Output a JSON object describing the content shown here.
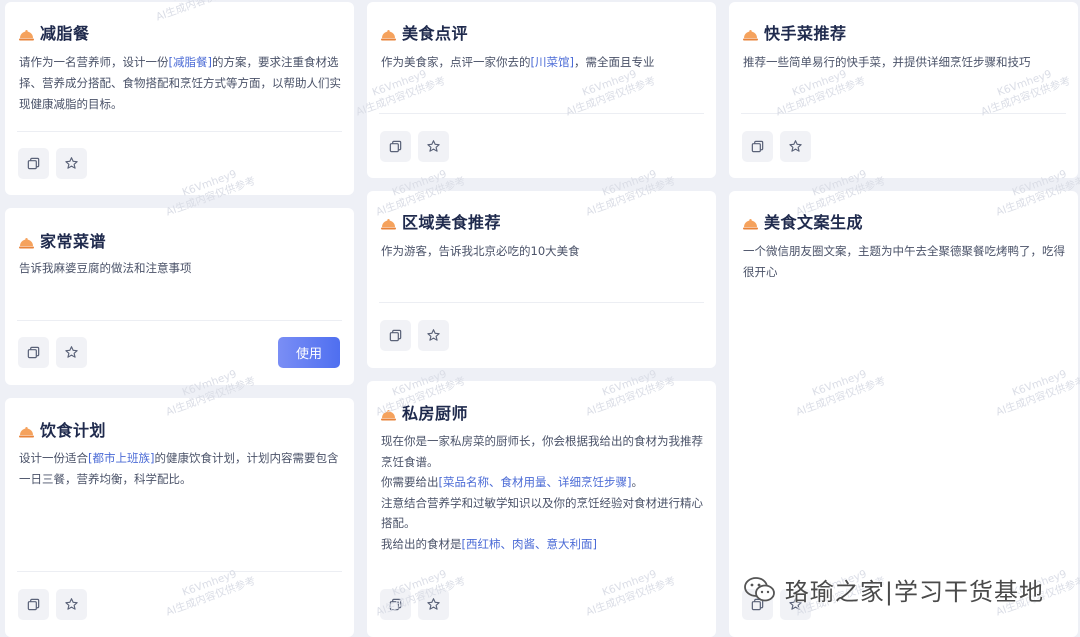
{
  "cards": [
    {
      "id": "jianzhican",
      "title": "减脂餐",
      "desc_parts": [
        {
          "text": "请作为一名营养师，设计一份"
        },
        {
          "text": "[减脂餐]",
          "hl": true
        },
        {
          "text": "的方案，要求注重食材选择、营养成分搭配、食物搭配和烹饪方式等方面，以帮助人们实现健康减脂的目标。"
        }
      ]
    },
    {
      "id": "meishidianping",
      "title": "美食点评",
      "desc_parts": [
        {
          "text": "作为美食家，点评一家你去的"
        },
        {
          "text": "[川菜馆]",
          "hl": true
        },
        {
          "text": "，需全面且专业"
        }
      ]
    },
    {
      "id": "kuaishoucai",
      "title": "快手菜推荐",
      "desc_parts": [
        {
          "text": "推荐一些简单易行的快手菜，并提供详细烹饪步骤和技巧"
        }
      ]
    },
    {
      "id": "jiachangcaipu",
      "title": "家常菜谱",
      "desc_parts": [
        {
          "text": "告诉我麻婆豆腐的做法和注意事项"
        }
      ],
      "use_label": "使用"
    },
    {
      "id": "quyumeishi",
      "title": "区域美食推荐",
      "desc_parts": [
        {
          "text": "作为游客，告诉我北京必吃的10大美食"
        }
      ]
    },
    {
      "id": "meishiwenan",
      "title": "美食文案生成",
      "desc_parts": [
        {
          "text": "一个微信朋友圈文案，主题为中午去全聚德聚餐吃烤鸭了，吃得很开心"
        }
      ]
    },
    {
      "id": "yinshijihua",
      "title": "饮食计划",
      "desc_parts": [
        {
          "text": "设计一份适合"
        },
        {
          "text": "[都市上班族]",
          "hl": true
        },
        {
          "text": "的健康饮食计划，计划内容需要包含一日三餐，营养均衡，科学配比。"
        }
      ]
    },
    {
      "id": "sifangchushi",
      "title": "私房厨师",
      "desc_lines": [
        [
          {
            "text": "现在你是一家私房菜的厨师长，你会根据我给出的食材为我推荐烹饪食谱。"
          }
        ],
        [
          {
            "text": "你需要给出"
          },
          {
            "text": "[菜品名称、食材用量、详细烹饪步骤]",
            "hl": true
          },
          {
            "text": "。"
          }
        ],
        [
          {
            "text": "注意结合营养学和过敏学知识以及你的烹饪经验对食材进行精心搭配。"
          }
        ],
        [
          {
            "text": "我给出的食材是"
          },
          {
            "text": "[西红柿、肉酱、意大利面]",
            "hl": true
          }
        ]
      ]
    }
  ],
  "watermark": {
    "line1": "K6Vmhey9",
    "line2": "AI生成内容仅供参考"
  },
  "brand": {
    "text": "珞瑜之家|学习干货基地"
  },
  "icons": {
    "copy": "copy-icon",
    "star": "star-icon",
    "dish": "dish-cover-icon",
    "wechat": "wechat-icon"
  },
  "colors": {
    "accent": "#4f6ff0",
    "highlight": "#4b6bd6",
    "title": "#1f2a4d",
    "dish_top": "#f5a25d",
    "dish_bottom": "#e8833a"
  }
}
